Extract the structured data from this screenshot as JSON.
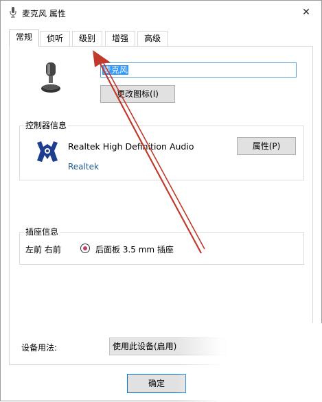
{
  "window": {
    "title": "麦克风 属性",
    "close_glyph": "✕"
  },
  "tabs": [
    {
      "label": "常规"
    },
    {
      "label": "侦听"
    },
    {
      "label": "级别"
    },
    {
      "label": "增强"
    },
    {
      "label": "高级"
    }
  ],
  "general": {
    "device_name": "麦克风",
    "change_icon_label": "更改图标(I)"
  },
  "controller": {
    "group_title": "控制器信息",
    "name": "Realtek High Definition Audio",
    "vendor": "Realtek",
    "properties_label": "属性(P)"
  },
  "jack": {
    "group_title": "插座信息",
    "position": "左前 右前",
    "description": "后面板 3.5 mm 插座",
    "jack_color": "#c23b6b"
  },
  "usage": {
    "label": "设备用法:",
    "value": "使用此设备(启用)"
  },
  "footer": {
    "ok_label": "确定"
  },
  "colors": {
    "annotation_arrow": "#c0392b",
    "selection": "#3399ff",
    "focus_border": "#5b9bd5"
  }
}
